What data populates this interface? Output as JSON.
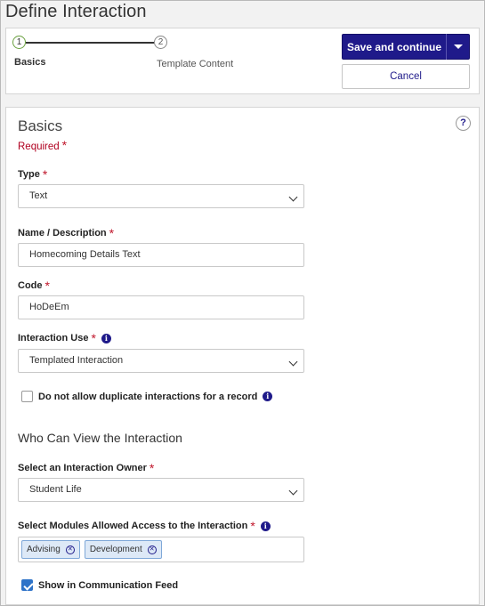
{
  "page": {
    "title": "Define Interaction"
  },
  "stepper": {
    "steps": [
      {
        "number": "1",
        "label": "Basics",
        "state": "active"
      },
      {
        "number": "2",
        "label": "Template Content",
        "state": "pending"
      }
    ]
  },
  "actions": {
    "save_label": "Save and continue",
    "cancel_label": "Cancel"
  },
  "section": {
    "title": "Basics",
    "help": "?",
    "required_note": "Required",
    "required_mark": "*"
  },
  "fields": {
    "type": {
      "label": "Type",
      "value": "Text"
    },
    "name": {
      "label": "Name / Description",
      "value": "Homecoming Details Text"
    },
    "code": {
      "label": "Code",
      "value": "HoDeEm"
    },
    "use": {
      "label": "Interaction Use",
      "value": "Templated Interaction"
    },
    "no_duplicates": {
      "label": "Do not allow duplicate interactions for a record",
      "checked": false
    },
    "owner": {
      "label": "Select an Interaction Owner",
      "value": "Student Life"
    },
    "modules": {
      "label": "Select Modules Allowed Access to the Interaction",
      "tags": [
        "Advising",
        "Development"
      ]
    },
    "show_feed": {
      "label": "Show in Communication Feed",
      "checked": true
    }
  },
  "visibility_section": {
    "title": "Who Can View the Interaction"
  },
  "icons": {
    "info": "info-icon",
    "remove": "remove-tag-icon",
    "chevron": "chevron-down-icon"
  },
  "colors": {
    "primary": "#1f1a8a",
    "required": "#c0162b",
    "step_active": "#6aa13f",
    "checkbox": "#2e73c8"
  }
}
